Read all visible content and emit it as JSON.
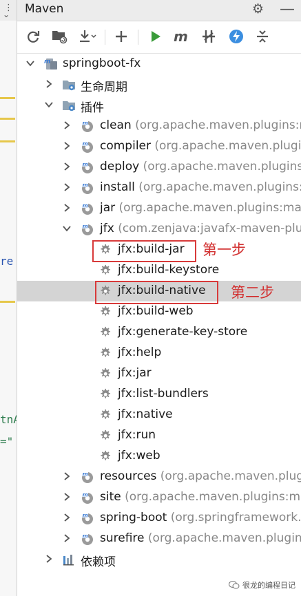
{
  "window": {
    "title": "Maven"
  },
  "toolbar": {
    "buttons": [
      "reload-icon",
      "add-folder-icon",
      "download-icon",
      "plus-icon",
      "run-icon",
      "m-icon",
      "skip-tests-icon",
      "lightning-icon",
      "collapse-all-icon"
    ]
  },
  "editor": {
    "fragments": [
      "re",
      "tnA",
      "=\""
    ]
  },
  "tree": {
    "project": "springboot-fx",
    "lifecycle": "生命周期",
    "plugins": "插件",
    "plugin_list": [
      {
        "name": "clean",
        "detail": "(org.apache.maven.plugins:maven-clean-plugin)"
      },
      {
        "name": "compiler",
        "detail": "(org.apache.maven.plugins:maven-compiler-plugin)"
      },
      {
        "name": "deploy",
        "detail": "(org.apache.maven.plugins:maven-deploy-plugin)"
      },
      {
        "name": "install",
        "detail": "(org.apache.maven.plugins:maven-install-plugin)"
      },
      {
        "name": "jar",
        "detail": "(org.apache.maven.plugins:maven-jar-plugin)"
      }
    ],
    "jfx": {
      "name": "jfx",
      "detail": "(com.zenjava:javafx-maven-plugin)"
    },
    "goals": [
      "jfx:build-jar",
      "jfx:build-keystore",
      "jfx:build-native",
      "jfx:build-web",
      "jfx:generate-key-store",
      "jfx:help",
      "jfx:jar",
      "jfx:list-bundlers",
      "jfx:native",
      "jfx:run",
      "jfx:web"
    ],
    "more_plugins": [
      {
        "name": "resources",
        "detail": "(org.apache.maven.plugins:maven-resources-plugin)"
      },
      {
        "name": "site",
        "detail": "(org.apache.maven.plugins:maven-site-plugin)"
      },
      {
        "name": "spring-boot",
        "detail": "(org.springframework.boot:spring-boot-maven-plugin)"
      },
      {
        "name": "surefire",
        "detail": "(org.apache.maven.plugins:maven-surefire-plugin)"
      }
    ],
    "dependencies": "依赖项"
  },
  "annotations": {
    "step1": "第一步",
    "step2": "第二步"
  },
  "watermark": "很龙的编程日记",
  "colors": {
    "annotation": "#d23030",
    "selected_row": "#d4d4d4",
    "run_green": "#3a9b3a",
    "lightning_blue": "#3b8ee0"
  }
}
